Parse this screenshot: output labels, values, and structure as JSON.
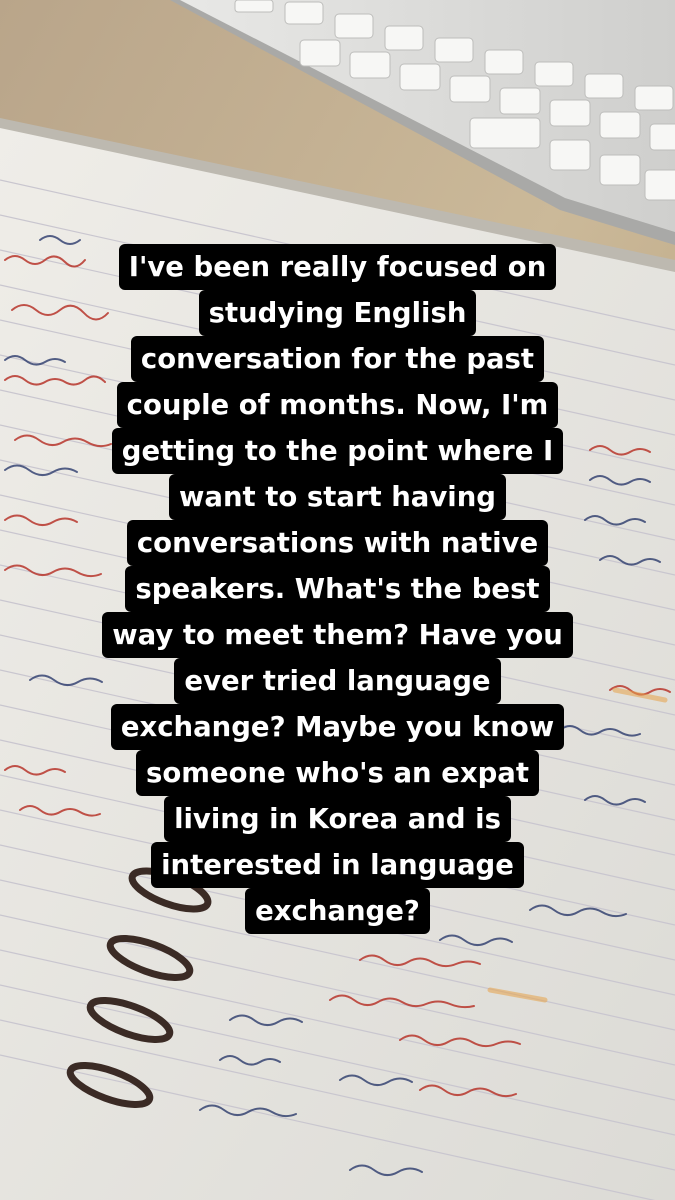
{
  "story": {
    "caption_lines": [
      "I've been really focused on",
      "studying English",
      "conversation for the past",
      "couple of months. Now, I'm",
      "getting to the point where I",
      "want to start having",
      "conversations with native",
      "speakers. What's the best",
      "way to meet them? Have you",
      "ever tried language",
      "exchange? Maybe you know",
      "someone who's an expat",
      "living in Korea and is",
      "interested in language",
      "exchange?"
    ]
  },
  "colors": {
    "caption_background": "#000000",
    "caption_text": "#ffffff",
    "handwriting_red": "#b8362c",
    "handwriting_navy": "#2b3a6b"
  }
}
